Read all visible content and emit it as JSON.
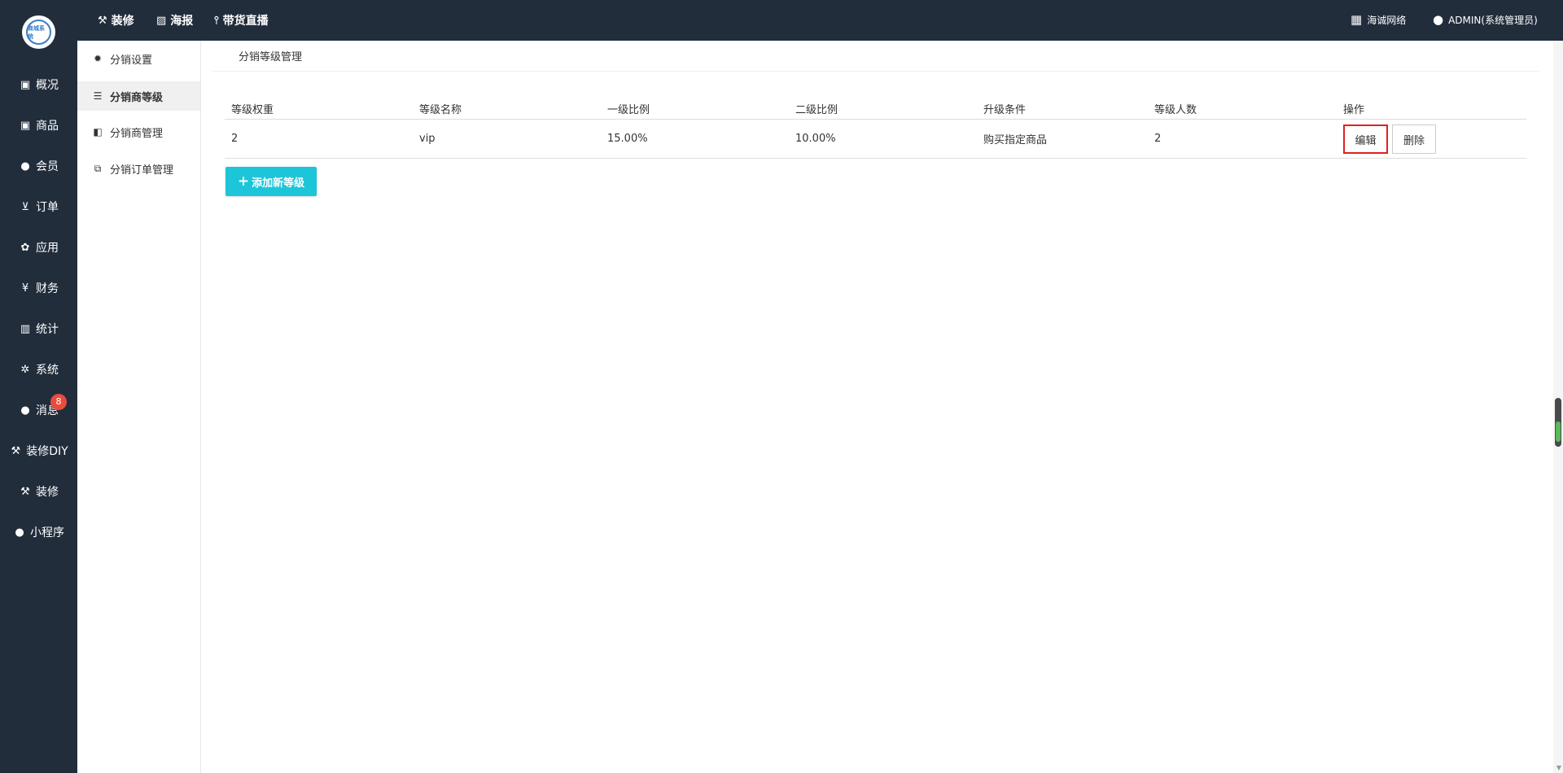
{
  "sidebar": {
    "logo_text": "商城系统",
    "items": [
      {
        "label": "概况",
        "icon": "dashboard-icon"
      },
      {
        "label": "商品",
        "icon": "box-icon"
      },
      {
        "label": "会员",
        "icon": "users-icon"
      },
      {
        "label": "订单",
        "icon": "cart-icon"
      },
      {
        "label": "应用",
        "icon": "cubes-icon"
      },
      {
        "label": "财务",
        "icon": "yen-icon"
      },
      {
        "label": "统计",
        "icon": "bar-chart-icon"
      },
      {
        "label": "系统",
        "icon": "gears-icon"
      },
      {
        "label": "消息",
        "icon": "chat-icon",
        "badge": "8"
      },
      {
        "label": "装修DIY",
        "icon": "hammer-icon"
      },
      {
        "label": "装修",
        "icon": "hammer-icon"
      },
      {
        "label": "小程序",
        "icon": "wechat-icon"
      }
    ]
  },
  "topbar": {
    "links": [
      {
        "label": "装修",
        "icon": "hammer-icon"
      },
      {
        "label": "海报",
        "icon": "image-icon"
      },
      {
        "label": "带货直播",
        "icon": "mic-icon"
      }
    ],
    "company": "海诚网络",
    "user": "ADMIN(系统管理员)"
  },
  "subnav": {
    "items": [
      {
        "label": "分销设置",
        "icon": "gear-icon"
      },
      {
        "label": "分销商等级",
        "icon": "sliders-icon"
      },
      {
        "label": "分销商管理",
        "icon": "share-icon"
      },
      {
        "label": "分销订单管理",
        "icon": "copy-icon"
      }
    ]
  },
  "main": {
    "title": "分销等级管理",
    "table": {
      "headers": [
        "等级权重",
        "等级名称",
        "一级比例",
        "二级比例",
        "升级条件",
        "等级人数",
        "操作"
      ],
      "rows": [
        {
          "weight": "2",
          "name": "vip",
          "level1": "15.00%",
          "level2": "10.00%",
          "condition": "购买指定商品",
          "count": "2",
          "edit": "编辑",
          "delete": "删除"
        }
      ]
    },
    "add_button": "添加新等级"
  },
  "colors": {
    "sidebar_bg": "#222d3c",
    "accent": "#1cc5d8",
    "badge": "#e84c3d",
    "highlight_border": "#e02020"
  }
}
